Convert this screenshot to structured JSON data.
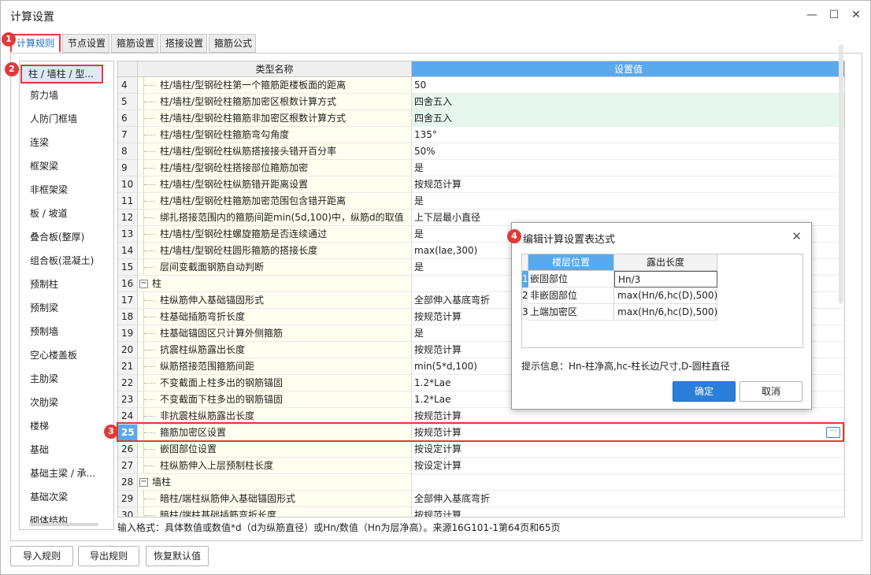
{
  "window": {
    "title": "计算设置",
    "minimize": "—",
    "maximize": "☐",
    "close": "✕"
  },
  "tabs": [
    "计算规则",
    "节点设置",
    "箍筋设置",
    "搭接设置",
    "箍筋公式"
  ],
  "sidebar": {
    "items": [
      "柱 / 墙柱 / 型...",
      "剪力墙",
      "人防门框墙",
      "连梁",
      "框架梁",
      "非框架梁",
      "板 / 坡道",
      "叠合板(整厚)",
      "组合板(混凝土)",
      "预制柱",
      "预制梁",
      "预制墙",
      "空心楼盖板",
      "主肋梁",
      "次肋梁",
      "楼梯",
      "基础",
      "基础主梁 / 承...",
      "基础次梁",
      "砌体结构"
    ]
  },
  "grid": {
    "header_name": "类型名称",
    "header_value": "设置值",
    "rows": [
      {
        "num": "4",
        "name": "柱/墙柱/型钢砼柱第一个箍筋距楼板面的距离",
        "value": "50",
        "kind": "item"
      },
      {
        "num": "5",
        "name": "柱/墙柱/型钢砼柱箍筋加密区根数计算方式",
        "value": "四舍五入",
        "kind": "item",
        "green": true
      },
      {
        "num": "6",
        "name": "柱/墙柱/型钢砼柱箍筋非加密区根数计算方式",
        "value": "四舍五入",
        "kind": "item",
        "green": true
      },
      {
        "num": "7",
        "name": "柱/墙柱/型钢砼柱箍筋弯勾角度",
        "value": "135°",
        "kind": "item"
      },
      {
        "num": "8",
        "name": "柱/墙柱/型钢砼柱纵筋搭接接头错开百分率",
        "value": "50%",
        "kind": "item"
      },
      {
        "num": "9",
        "name": "柱/墙柱/型钢砼柱搭接部位箍筋加密",
        "value": "是",
        "kind": "item"
      },
      {
        "num": "10",
        "name": "柱/墙柱/型钢砼柱纵筋错开距离设置",
        "value": "按规范计算",
        "kind": "item"
      },
      {
        "num": "11",
        "name": "柱/墙柱/型钢砼柱箍筋加密范围包含错开距离",
        "value": "是",
        "kind": "item"
      },
      {
        "num": "12",
        "name": "绑扎搭接范围内的箍筋间距min(5d,100)中，纵筋d的取值",
        "value": "上下层最小直径",
        "kind": "item"
      },
      {
        "num": "13",
        "name": "柱/墙柱/型钢砼柱螺旋箍筋是否连续通过",
        "value": "是",
        "kind": "item"
      },
      {
        "num": "14",
        "name": "柱/墙柱/型钢砼柱圆形箍筋的搭接长度",
        "value": "max(lae,300)",
        "kind": "item"
      },
      {
        "num": "15",
        "name": "层间变截面钢筋自动判断",
        "value": "是",
        "kind": "item"
      },
      {
        "num": "16",
        "name": "柱",
        "value": "",
        "kind": "group"
      },
      {
        "num": "17",
        "name": "柱纵筋伸入基础锚固形式",
        "value": "全部伸入基底弯折",
        "kind": "item"
      },
      {
        "num": "18",
        "name": "柱基础插筋弯折长度",
        "value": "按规范计算",
        "kind": "item"
      },
      {
        "num": "19",
        "name": "柱基础锚固区只计算外侧箍筋",
        "value": "是",
        "kind": "item"
      },
      {
        "num": "20",
        "name": "抗震柱纵筋露出长度",
        "value": "按规范计算",
        "kind": "item"
      },
      {
        "num": "21",
        "name": "纵筋搭接范围箍筋间距",
        "value": "min(5*d,100)",
        "kind": "item"
      },
      {
        "num": "22",
        "name": "不变截面上柱多出的钢筋锚固",
        "value": "1.2*Lae",
        "kind": "item"
      },
      {
        "num": "23",
        "name": "不变截面下柱多出的钢筋锚固",
        "value": "1.2*Lae",
        "kind": "item"
      },
      {
        "num": "24",
        "name": "非抗震柱纵筋露出长度",
        "value": "按规范计算",
        "kind": "item"
      },
      {
        "num": "25",
        "name": "箍筋加密区设置",
        "value": "按规范计算",
        "kind": "item",
        "selected": true
      },
      {
        "num": "26",
        "name": "嵌固部位设置",
        "value": "按设定计算",
        "kind": "item"
      },
      {
        "num": "27",
        "name": "柱纵筋伸入上层预制柱长度",
        "value": "按设定计算",
        "kind": "item"
      },
      {
        "num": "28",
        "name": "墙柱",
        "value": "",
        "kind": "group"
      },
      {
        "num": "29",
        "name": "暗柱/端柱纵筋伸入基础锚固形式",
        "value": "全部伸入基底弯折",
        "kind": "item"
      },
      {
        "num": "30",
        "name": "暗柱/端柱基础插筋弯折长度",
        "value": "按规范计算",
        "kind": "item"
      }
    ],
    "ellipsis_label": "···"
  },
  "input_hint": "输入格式：具体数值或数值*d（d为纵筋直径）或Hn/数值（Hn为层净高）。来源16G101-1第64页和65页",
  "bottom_buttons": {
    "import": "导入规则",
    "export": "导出规则",
    "restore": "恢复默认值"
  },
  "badges": [
    "1",
    "2",
    "3",
    "4"
  ],
  "dialog": {
    "title": "编辑计算设置表达式",
    "close": "✕",
    "col_position": "楼层位置",
    "col_length": "露出长度",
    "rows": [
      {
        "num": "1",
        "position": "嵌固部位",
        "length": "Hn/3"
      },
      {
        "num": "2",
        "position": "非嵌固部位",
        "length": "max(Hn/6,hc(D),500)"
      },
      {
        "num": "3",
        "position": "上端加密区",
        "length": "max(Hn/6,hc(D),500)"
      }
    ],
    "hint": "提示信息：Hn-柱净高,hc-柱长边尺寸,D-圆柱直径",
    "ok": "确定",
    "cancel": "取消"
  },
  "colors": {
    "accent": "#1d6fd1",
    "highlight": "#e03a3a",
    "name_column_bg": "#fffff0",
    "green_row_bg": "#e5f7ec",
    "header_value_bg": "#5aa9ec"
  }
}
